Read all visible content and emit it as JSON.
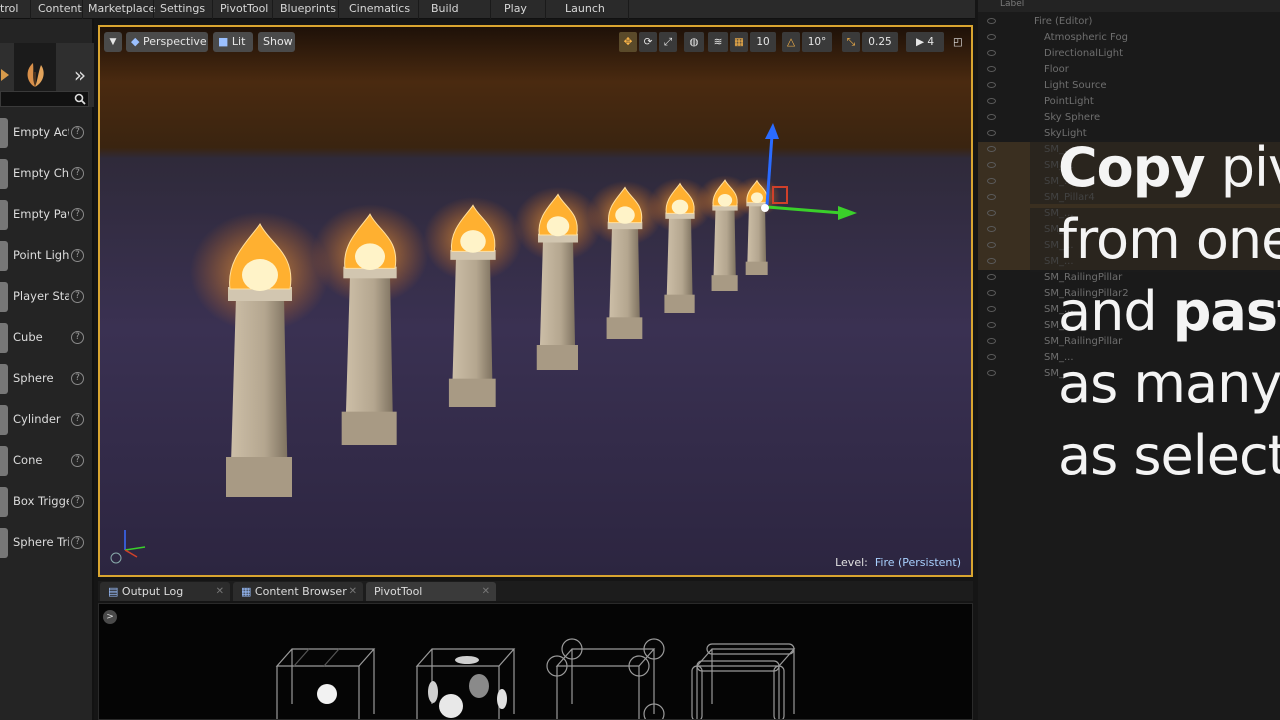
{
  "toolbar": {
    "items": [
      "trol",
      "Content",
      "Marketplace",
      "Settings",
      "PivotTool",
      "Blueprints",
      "Cinematics",
      "Build",
      "Play",
      "Launch"
    ]
  },
  "modes": {
    "place_items": [
      "Empty Acto",
      "Empty Cha",
      "Empty Paw",
      "Point Light",
      "Player Sta",
      "Cube",
      "Sphere",
      "Cylinder",
      "Cone",
      "Box Trigge",
      "Sphere Tri"
    ],
    "help_glyph": "?"
  },
  "viewport": {
    "view_mode": "Perspective",
    "lighting": "Lit",
    "show": "Show",
    "grid_snap": "10",
    "rotation_snap": "10°",
    "scale_snap": "0.25",
    "camera_speed": "4",
    "level_label": "Level:",
    "level_value": "Fire (Persistent)"
  },
  "bottom_tabs": [
    {
      "label": "Output Log"
    },
    {
      "label": "Content Browser"
    },
    {
      "label": "PivotTool"
    }
  ],
  "console_glyph": ">",
  "outliner": {
    "header": "Label",
    "rows": [
      "Fire (Editor)",
      "Atmospheric Fog",
      "DirectionalLight",
      "Floor",
      "Light Source",
      "PointLight",
      "Sky Sphere",
      "SkyLight",
      "SM_...",
      "SM_...",
      "SM_...",
      "SM_Pillar4",
      "SM_...",
      "SM_...",
      "SM_...",
      "SM_...",
      "SM_RailingPillar",
      "SM_RailingPillar2",
      "SM_...",
      "SM_...",
      "SM_RailingPillar",
      "SM_...",
      "SM_..."
    ]
  },
  "overlay": {
    "line1_bold": "Copy",
    "line1_rest": " piv",
    "line2": "from one",
    "line3_rest": "and ",
    "line3_bold": "paste",
    "line4": "as many a",
    "line5": "as selecte"
  },
  "colors": {
    "viewport_border": "#d9a530",
    "flame": "#ffb030",
    "level_value": "#a9d1ff"
  }
}
